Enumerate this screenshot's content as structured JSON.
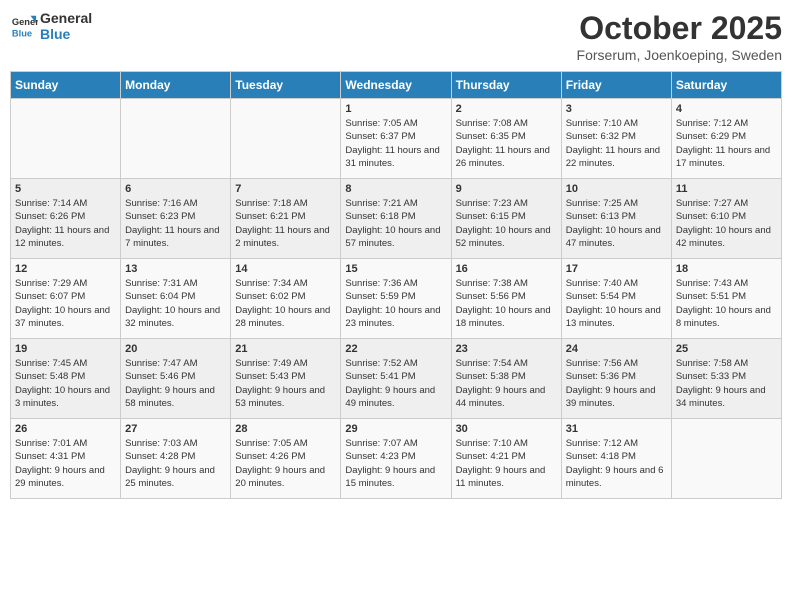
{
  "header": {
    "logo_general": "General",
    "logo_blue": "Blue",
    "month": "October 2025",
    "location": "Forserum, Joenkoeping, Sweden"
  },
  "weekdays": [
    "Sunday",
    "Monday",
    "Tuesday",
    "Wednesday",
    "Thursday",
    "Friday",
    "Saturday"
  ],
  "weeks": [
    [
      {
        "day": "",
        "info": ""
      },
      {
        "day": "",
        "info": ""
      },
      {
        "day": "",
        "info": ""
      },
      {
        "day": "1",
        "info": "Sunrise: 7:05 AM\nSunset: 6:37 PM\nDaylight: 11 hours and 31 minutes."
      },
      {
        "day": "2",
        "info": "Sunrise: 7:08 AM\nSunset: 6:35 PM\nDaylight: 11 hours and 26 minutes."
      },
      {
        "day": "3",
        "info": "Sunrise: 7:10 AM\nSunset: 6:32 PM\nDaylight: 11 hours and 22 minutes."
      },
      {
        "day": "4",
        "info": "Sunrise: 7:12 AM\nSunset: 6:29 PM\nDaylight: 11 hours and 17 minutes."
      }
    ],
    [
      {
        "day": "5",
        "info": "Sunrise: 7:14 AM\nSunset: 6:26 PM\nDaylight: 11 hours and 12 minutes."
      },
      {
        "day": "6",
        "info": "Sunrise: 7:16 AM\nSunset: 6:23 PM\nDaylight: 11 hours and 7 minutes."
      },
      {
        "day": "7",
        "info": "Sunrise: 7:18 AM\nSunset: 6:21 PM\nDaylight: 11 hours and 2 minutes."
      },
      {
        "day": "8",
        "info": "Sunrise: 7:21 AM\nSunset: 6:18 PM\nDaylight: 10 hours and 57 minutes."
      },
      {
        "day": "9",
        "info": "Sunrise: 7:23 AM\nSunset: 6:15 PM\nDaylight: 10 hours and 52 minutes."
      },
      {
        "day": "10",
        "info": "Sunrise: 7:25 AM\nSunset: 6:13 PM\nDaylight: 10 hours and 47 minutes."
      },
      {
        "day": "11",
        "info": "Sunrise: 7:27 AM\nSunset: 6:10 PM\nDaylight: 10 hours and 42 minutes."
      }
    ],
    [
      {
        "day": "12",
        "info": "Sunrise: 7:29 AM\nSunset: 6:07 PM\nDaylight: 10 hours and 37 minutes."
      },
      {
        "day": "13",
        "info": "Sunrise: 7:31 AM\nSunset: 6:04 PM\nDaylight: 10 hours and 32 minutes."
      },
      {
        "day": "14",
        "info": "Sunrise: 7:34 AM\nSunset: 6:02 PM\nDaylight: 10 hours and 28 minutes."
      },
      {
        "day": "15",
        "info": "Sunrise: 7:36 AM\nSunset: 5:59 PM\nDaylight: 10 hours and 23 minutes."
      },
      {
        "day": "16",
        "info": "Sunrise: 7:38 AM\nSunset: 5:56 PM\nDaylight: 10 hours and 18 minutes."
      },
      {
        "day": "17",
        "info": "Sunrise: 7:40 AM\nSunset: 5:54 PM\nDaylight: 10 hours and 13 minutes."
      },
      {
        "day": "18",
        "info": "Sunrise: 7:43 AM\nSunset: 5:51 PM\nDaylight: 10 hours and 8 minutes."
      }
    ],
    [
      {
        "day": "19",
        "info": "Sunrise: 7:45 AM\nSunset: 5:48 PM\nDaylight: 10 hours and 3 minutes."
      },
      {
        "day": "20",
        "info": "Sunrise: 7:47 AM\nSunset: 5:46 PM\nDaylight: 9 hours and 58 minutes."
      },
      {
        "day": "21",
        "info": "Sunrise: 7:49 AM\nSunset: 5:43 PM\nDaylight: 9 hours and 53 minutes."
      },
      {
        "day": "22",
        "info": "Sunrise: 7:52 AM\nSunset: 5:41 PM\nDaylight: 9 hours and 49 minutes."
      },
      {
        "day": "23",
        "info": "Sunrise: 7:54 AM\nSunset: 5:38 PM\nDaylight: 9 hours and 44 minutes."
      },
      {
        "day": "24",
        "info": "Sunrise: 7:56 AM\nSunset: 5:36 PM\nDaylight: 9 hours and 39 minutes."
      },
      {
        "day": "25",
        "info": "Sunrise: 7:58 AM\nSunset: 5:33 PM\nDaylight: 9 hours and 34 minutes."
      }
    ],
    [
      {
        "day": "26",
        "info": "Sunrise: 7:01 AM\nSunset: 4:31 PM\nDaylight: 9 hours and 29 minutes."
      },
      {
        "day": "27",
        "info": "Sunrise: 7:03 AM\nSunset: 4:28 PM\nDaylight: 9 hours and 25 minutes."
      },
      {
        "day": "28",
        "info": "Sunrise: 7:05 AM\nSunset: 4:26 PM\nDaylight: 9 hours and 20 minutes."
      },
      {
        "day": "29",
        "info": "Sunrise: 7:07 AM\nSunset: 4:23 PM\nDaylight: 9 hours and 15 minutes."
      },
      {
        "day": "30",
        "info": "Sunrise: 7:10 AM\nSunset: 4:21 PM\nDaylight: 9 hours and 11 minutes."
      },
      {
        "day": "31",
        "info": "Sunrise: 7:12 AM\nSunset: 4:18 PM\nDaylight: 9 hours and 6 minutes."
      },
      {
        "day": "",
        "info": ""
      }
    ]
  ]
}
